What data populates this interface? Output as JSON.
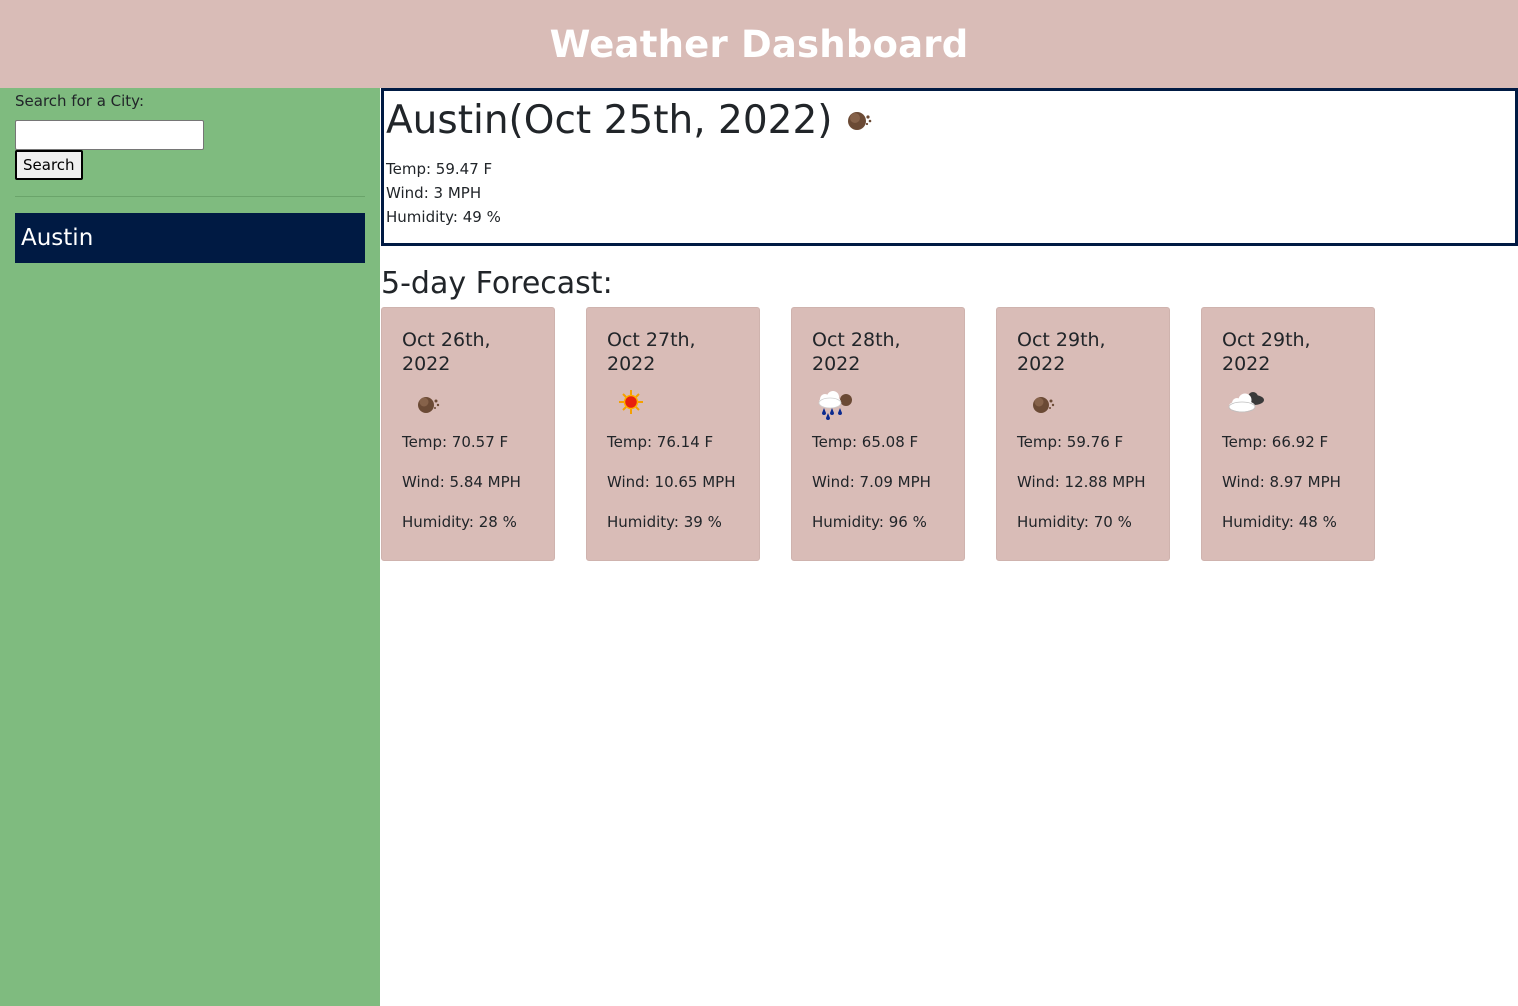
{
  "header": {
    "title": "Weather Dashboard"
  },
  "sidebar": {
    "search_label": "Search for a City:",
    "search_value": "",
    "search_button": "Search",
    "history": [
      {
        "label": "Austin"
      }
    ]
  },
  "current": {
    "title": "Austin(Oct 25th, 2022)",
    "icon": "broken-clouds-icon",
    "temp": "Temp: 59.47 F",
    "wind": "Wind: 3 MPH",
    "humidity": "Humidity: 49 %"
  },
  "forecast": {
    "title": "5-day Forecast:",
    "days": [
      {
        "date": "Oct 26th, 2022",
        "icon": "broken-clouds-icon",
        "temp": "Temp: 70.57 F",
        "wind": "Wind: 5.84 MPH",
        "humidity": "Humidity: 28 %"
      },
      {
        "date": "Oct 27th, 2022",
        "icon": "sun-icon",
        "temp": "Temp: 76.14 F",
        "wind": "Wind: 10.65 MPH",
        "humidity": "Humidity: 39 %"
      },
      {
        "date": "Oct 28th, 2022",
        "icon": "rain-icon",
        "temp": "Temp: 65.08 F",
        "wind": "Wind: 7.09 MPH",
        "humidity": "Humidity: 96 %"
      },
      {
        "date": "Oct 29th, 2022",
        "icon": "broken-clouds-icon",
        "temp": "Temp: 59.76 F",
        "wind": "Wind: 12.88 MPH",
        "humidity": "Humidity: 70 %"
      },
      {
        "date": "Oct 29th, 2022",
        "icon": "clouds-icon",
        "temp": "Temp: 66.92 F",
        "wind": "Wind: 8.97 MPH",
        "humidity": "Humidity: 48 %"
      }
    ]
  },
  "colors": {
    "header_bg": "#d9bcb7",
    "sidebar_bg": "#7fbb7f",
    "history_item_bg": "#001a43",
    "card_bg": "#d9bcb7",
    "current_border": "#001a43"
  }
}
